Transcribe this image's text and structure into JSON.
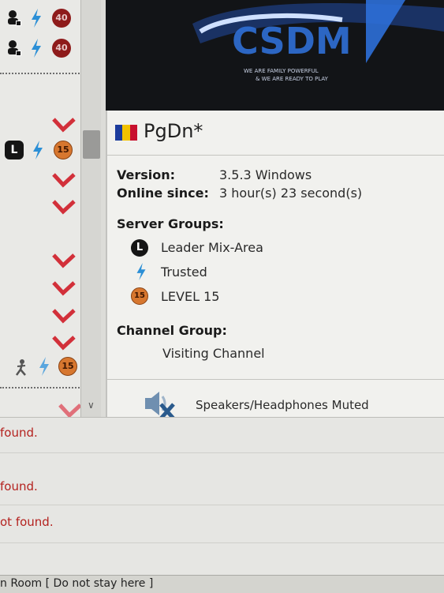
{
  "client": {
    "nickname": "PgDn*",
    "flag_colors": [
      "#1c3b9c",
      "#f2c200",
      "#c8102e"
    ],
    "version_label": "Version:",
    "version_value": "3.5.3 Windows",
    "online_label": "Online since:",
    "online_value": "3 hour(s) 23 second(s)",
    "server_groups_label": "Server Groups:",
    "server_groups": [
      {
        "icon": "leader-icon",
        "badge": "L",
        "name": "Leader Mix-Area"
      },
      {
        "icon": "lightning-icon",
        "badge": "",
        "name": "Trusted"
      },
      {
        "icon": "level-15-badge-icon",
        "badge": "15",
        "name": "LEVEL 15"
      }
    ],
    "channel_group_label": "Channel Group:",
    "channel_group": "Visiting Channel",
    "audio_status": "Speakers/Headphones Muted"
  },
  "banner": {
    "logo_text": "CSDM",
    "tagline_1": "WE ARE FAMILY POWERFUL",
    "tagline_2": "& WE ARE READY TO PLAY"
  },
  "tree": {
    "badge_40": "40",
    "badge_15": "15",
    "leader_letter": "L"
  },
  "log": {
    "lines": [
      "found.",
      "found.",
      "ot found."
    ]
  },
  "status_bar": {
    "text": "n Room [ Do not stay here ]"
  },
  "colors": {
    "accent_red": "#c8102e",
    "lightning_blue": "#2b8fd6",
    "log_error": "#b4221f"
  }
}
